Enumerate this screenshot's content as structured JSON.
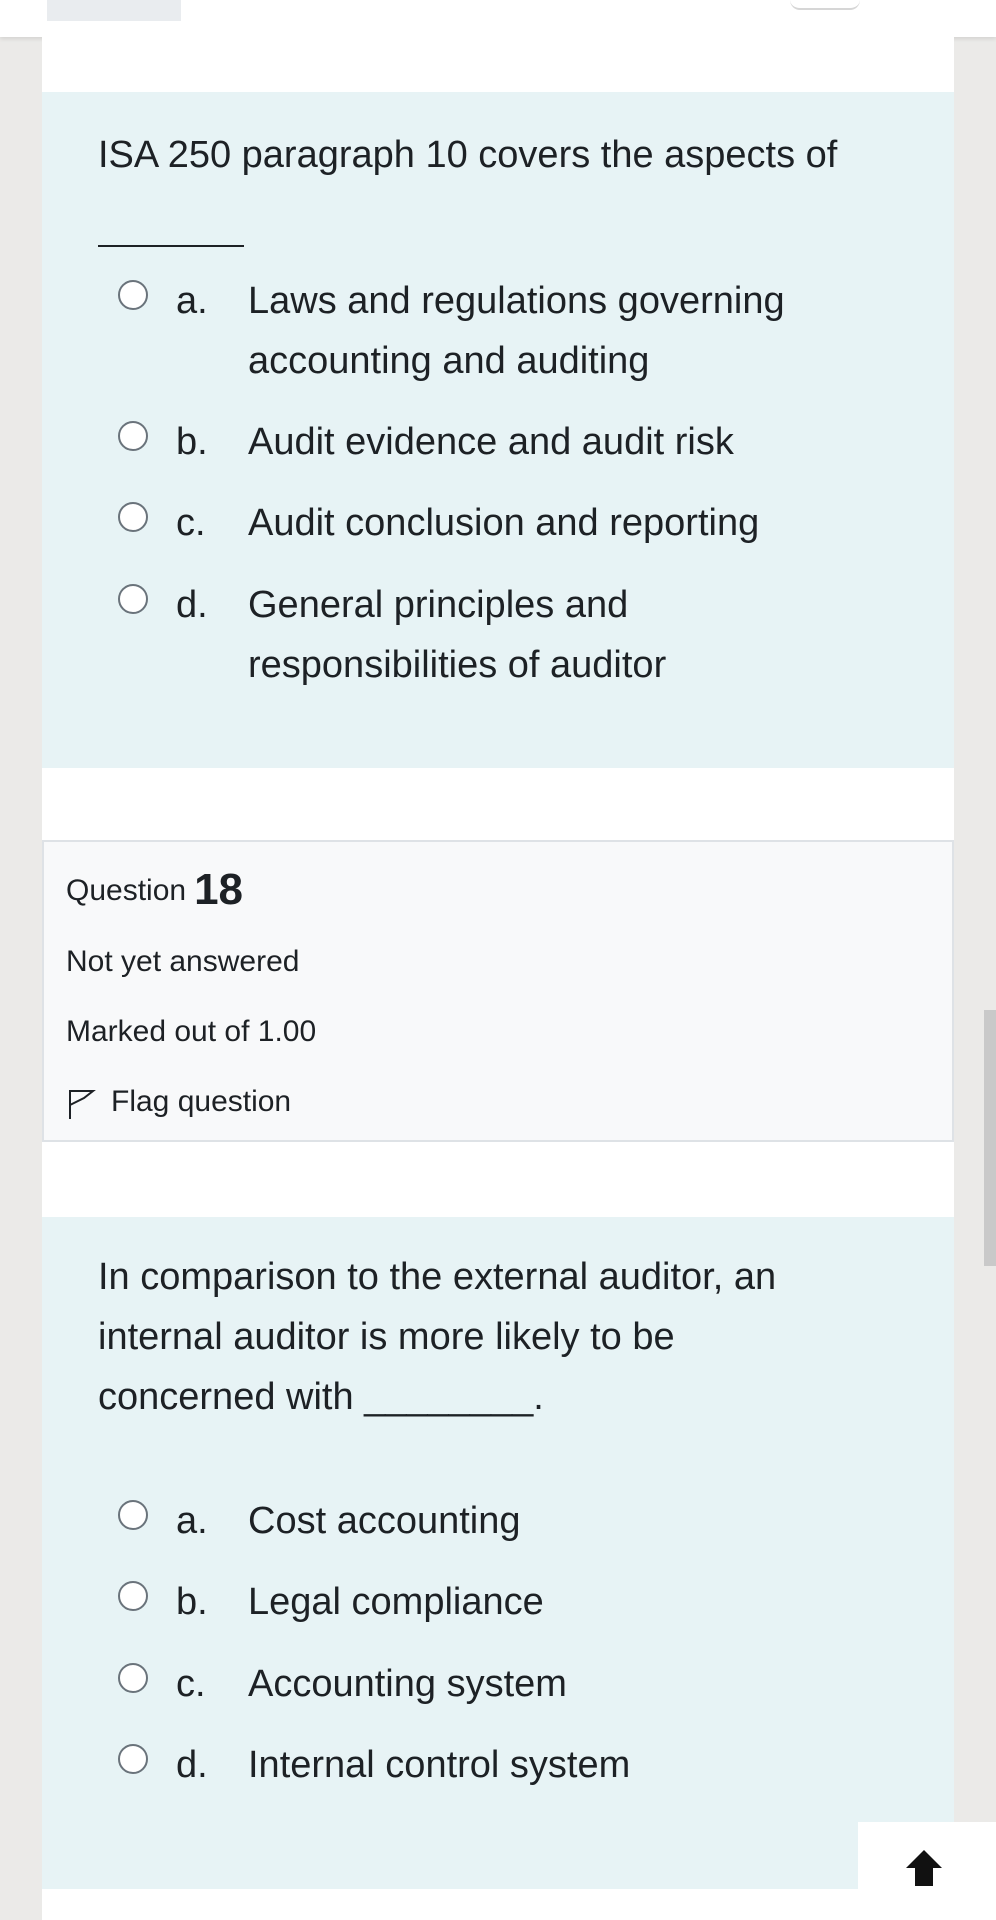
{
  "q17": {
    "question_text": "ISA 250 paragraph 10 covers the aspects of",
    "options": [
      {
        "letter": "a.",
        "lines": [
          "Laws and regulations governing",
          "accounting and auditing"
        ]
      },
      {
        "letter": "b.",
        "lines": [
          "Audit evidence and audit risk"
        ]
      },
      {
        "letter": "c.",
        "lines": [
          "Audit conclusion and reporting"
        ]
      },
      {
        "letter": "d.",
        "lines": [
          "General principles and",
          "responsibilities of auditor"
        ]
      }
    ]
  },
  "q18": {
    "info": {
      "label": "Question",
      "number": "18",
      "status": "Not yet answered",
      "marked": "Marked out of 1.00",
      "flag_label": "Flag question"
    },
    "question_lines": [
      "In comparison to the external auditor, an",
      "internal auditor is more likely to be",
      "concerned with ________."
    ],
    "options": [
      {
        "letter": "a.",
        "text": "Cost accounting"
      },
      {
        "letter": "b.",
        "text": "Legal compliance"
      },
      {
        "letter": "c.",
        "text": "Accounting system"
      },
      {
        "letter": "d.",
        "text": "Internal control system"
      }
    ]
  },
  "icons": {
    "flag": "flag-outline-icon",
    "back_to_top": "arrow-up-icon"
  },
  "colors": {
    "question_bg": "#e7f3f5",
    "info_bg": "#f8f9fa",
    "page_bg": "#ebeae8"
  }
}
